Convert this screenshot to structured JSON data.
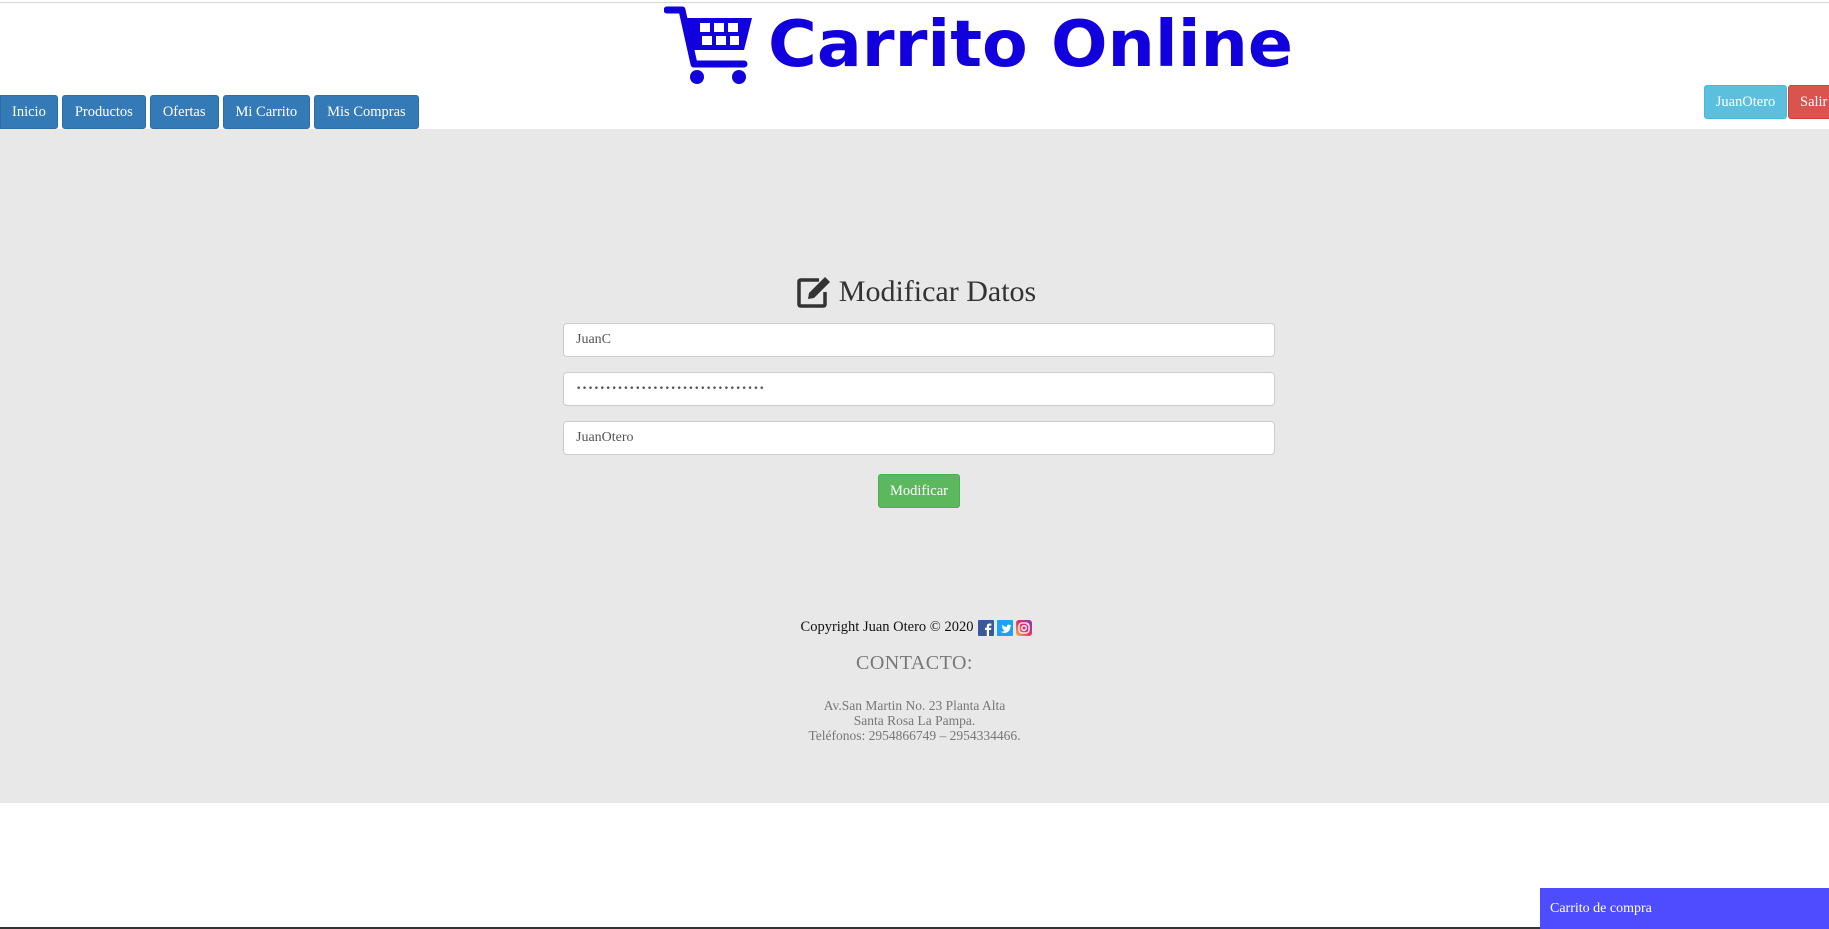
{
  "header": {
    "logo_text": "Carrito Online",
    "logo_icon": "shopping-cart-icon",
    "brand_color": "#1100dd"
  },
  "nav": {
    "items": [
      "Inicio",
      "Productos",
      "Ofertas",
      "Mi Carrito",
      "Mis Compras"
    ]
  },
  "user": {
    "username_button": "JuanOtero",
    "logout_button": "Salir"
  },
  "form": {
    "title": "Modificar Datos",
    "title_icon": "edit-icon",
    "fields": [
      {
        "name": "username",
        "value": "JuanC"
      },
      {
        "name": "password",
        "value": "••••••••••••••••••••••••••••••••"
      },
      {
        "name": "display-name",
        "value": "JuanOtero"
      }
    ],
    "submit_label": "Modificar"
  },
  "footer": {
    "copyright": "Copyright Juan Otero © 2020",
    "social_icons": [
      "facebook-icon",
      "twitter-icon",
      "instagram-icon"
    ],
    "contact_title": "CONTACTO:",
    "address_lines": [
      "Av.San Martin No. 23 Planta Alta",
      "Santa Rosa La Pampa.",
      "Teléfonos: 2954866749 – 2954334466."
    ]
  },
  "cart_widget": {
    "label": "Carrito de compra"
  },
  "colors": {
    "nav_primary": "#337ab7",
    "user_info": "#5bc0de",
    "danger": "#d9534f",
    "success": "#5cb85c",
    "cart_widget": "#4d4dff",
    "main_bg": "#e8e8e8"
  }
}
